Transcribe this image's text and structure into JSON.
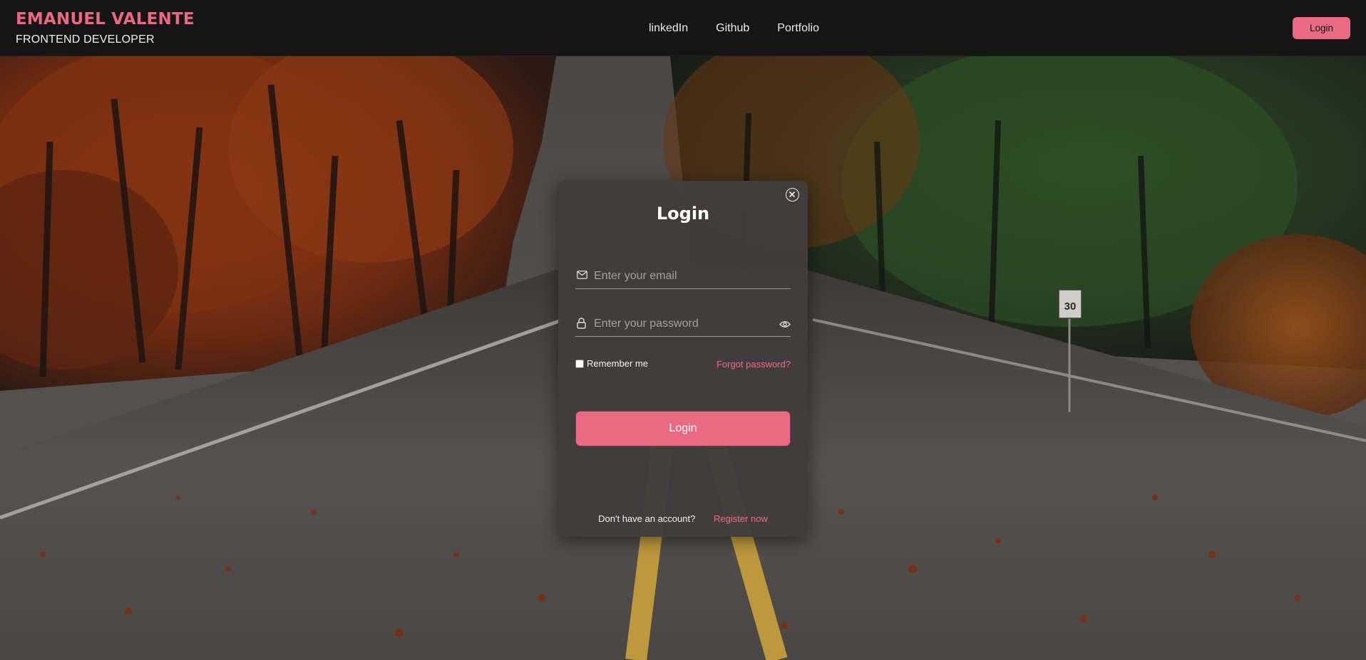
{
  "brand": {
    "name": "EMANUEL VALENTE",
    "role": "FRONTEND DEVELOPER",
    "accent_color": "#ea6a83"
  },
  "nav": {
    "items": [
      {
        "label": "linkedIn"
      },
      {
        "label": "Github"
      },
      {
        "label": "Portfolio"
      }
    ],
    "login_label": "Login"
  },
  "modal": {
    "title": "Login",
    "close_icon": "close-circle-icon",
    "email": {
      "placeholder": "Enter your email",
      "icon": "mail-icon"
    },
    "password": {
      "placeholder": "Enter your password",
      "icon": "lock-icon",
      "toggle_icon": "eye-icon"
    },
    "remember_label": "Remember me",
    "forgot_label": "Forgot password?",
    "submit_label": "Login",
    "footer": {
      "question": "Don't have an account?",
      "register_label": "Register now"
    }
  }
}
